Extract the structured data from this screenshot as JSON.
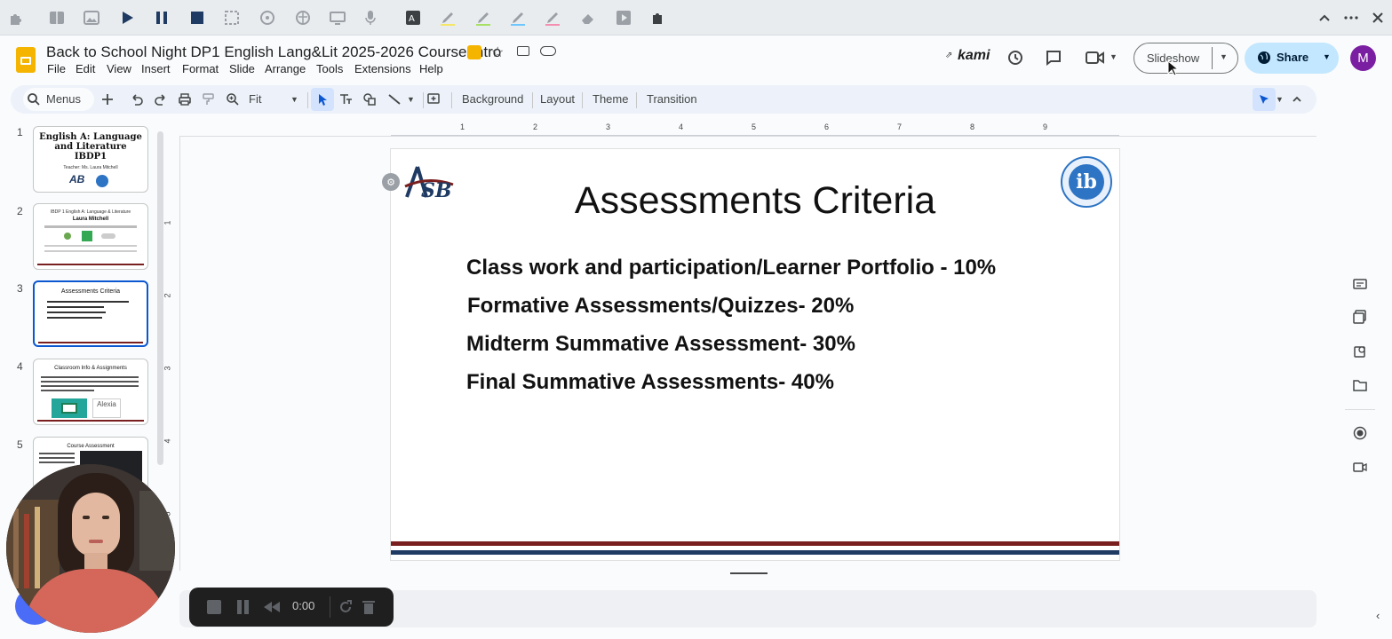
{
  "extension_bar": {
    "icons": [
      "puzzle-icon",
      "book-icon",
      "image-icon",
      "play-icon",
      "pause-icon",
      "stop-icon",
      "select-area-icon",
      "audio-icon",
      "brain-icon",
      "screen-icon",
      "mic-icon",
      "translate-icon",
      "highlighter-yellow-icon",
      "highlighter-green-icon",
      "highlighter-blue-icon",
      "highlighter-pink-icon",
      "eraser-icon",
      "play-box-icon",
      "puzzle-piece-icon"
    ],
    "colors": {
      "play": "#1f3b63",
      "background": "#e9ecef"
    }
  },
  "document": {
    "title": "Back to School Night DP1 English Lang&Lit 2025-2026 Course Intro",
    "menus": [
      "File",
      "Edit",
      "View",
      "Insert",
      "Format",
      "Slide",
      "Arrange",
      "Tools",
      "Extensions",
      "Help"
    ]
  },
  "header_right": {
    "kami_label": "kami",
    "slideshow_label": "Slideshow",
    "share_label": "Share",
    "avatar_letter": "M",
    "avatar_color": "#7b1fa2",
    "share_color": "#c2e7ff"
  },
  "toolbar": {
    "menus_label": "Menus",
    "zoom_label": "Fit",
    "background_label": "Background",
    "layout_label": "Layout",
    "theme_label": "Theme",
    "transition_label": "Transition"
  },
  "ruler": {
    "h_ticks": [
      "1",
      "2",
      "3",
      "4",
      "5",
      "6",
      "7",
      "8",
      "9"
    ],
    "v_ticks": [
      "1",
      "2",
      "3",
      "4",
      "5"
    ]
  },
  "filmstrip": {
    "slides": [
      {
        "num": "1",
        "title": "English A: Language and Literature IBDP1",
        "sub": "Teacher: Ms. Laura Mitchell"
      },
      {
        "num": "2",
        "title": "IBDP 1 English A: Language & Literature",
        "sub": "Laura Mitchell"
      },
      {
        "num": "3",
        "title": "Assessments Criteria",
        "sub": ""
      },
      {
        "num": "4",
        "title": "Classroom Info & Assignments",
        "sub": "Alexia"
      },
      {
        "num": "5",
        "title": "Course Assessment",
        "sub": ""
      }
    ],
    "active_index": 2
  },
  "slide": {
    "title": "Assessments Criteria",
    "criteria": [
      "Class work and participation/Learner Portfolio - 10%",
      "Formative Assessments/Quizzes- 20%",
      "Midterm Summative Assessment- 30%",
      "Final Summative Assessments- 40%"
    ],
    "logo_left": "ASB",
    "logo_right": "ib",
    "stripe_colors": {
      "top": "#7a1f1f",
      "bottom": "#1f3a63"
    }
  },
  "recorder": {
    "time": "0:00"
  }
}
